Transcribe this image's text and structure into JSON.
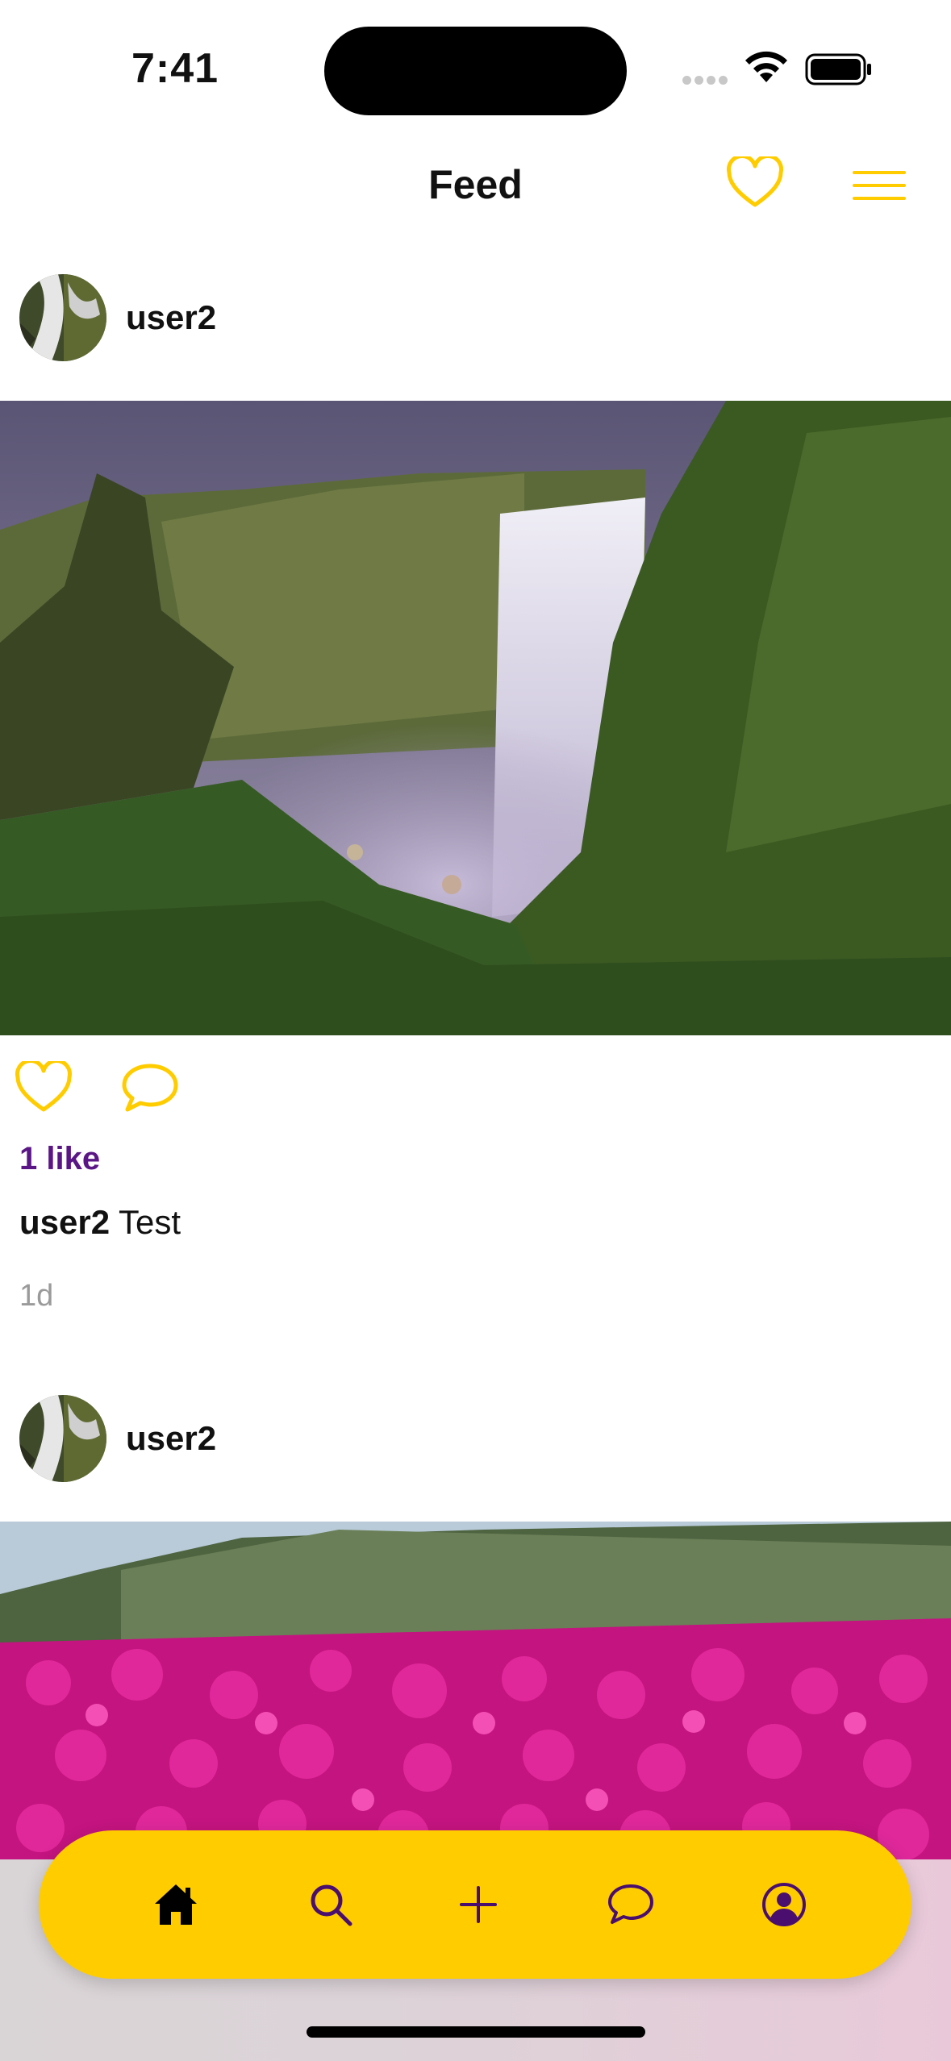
{
  "status_bar": {
    "time": "7:41"
  },
  "header": {
    "title": "Feed"
  },
  "colors": {
    "accent": "#ffcc00",
    "likes_text": "#5a1685",
    "tab_icon": "#4a0f6e",
    "timestamp": "#9a9a9a"
  },
  "posts": [
    {
      "username": "user2",
      "likes": "1 like",
      "caption_user": "user2",
      "caption_text": "Test",
      "time": "1d"
    },
    {
      "username": "user2"
    }
  ],
  "tab_bar": {
    "items": [
      {
        "icon": "home-icon"
      },
      {
        "icon": "search-icon"
      },
      {
        "icon": "plus-icon"
      },
      {
        "icon": "chat-bubble-icon"
      },
      {
        "icon": "profile-icon"
      }
    ]
  }
}
